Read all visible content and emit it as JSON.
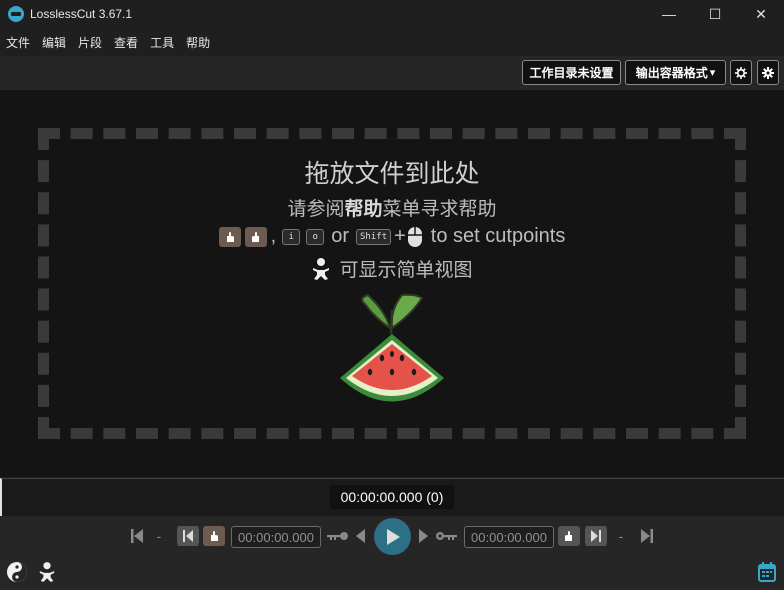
{
  "window": {
    "title": "LosslessCut 3.67.1",
    "minimize": "—",
    "maximize": "☐",
    "close": "✕"
  },
  "menu": [
    "文件",
    "编辑",
    "片段",
    "查看",
    "工具",
    "帮助"
  ],
  "toolbar": {
    "working_dir": "工作目录未设置",
    "output_format": "输出容器格式",
    "output_format_arrow": "▾"
  },
  "dropzone": {
    "title": "拖放文件到此处",
    "help_prefix": "请参阅",
    "help_bold": "帮助",
    "help_suffix": "菜单寻求帮助",
    "cut_sep1": ",",
    "key_i": "i",
    "key_o": "o",
    "cut_or": "or",
    "key_shift": "Shift",
    "cut_plus": "+",
    "cut_suffix": "to set cutpoints",
    "simple_view": "可显示简单视图"
  },
  "timeline": {
    "timecode": "00:00:00.000 (0)"
  },
  "controls": {
    "dash_left": "-",
    "cut_start_time": "00:00:00.000",
    "cut_end_time": "00:00:00.000",
    "dash_right": "-"
  },
  "colors": {
    "accent": "#2d6f84",
    "calendar_icon": "#3aa7c9",
    "hand_button": "#6d5a50"
  }
}
